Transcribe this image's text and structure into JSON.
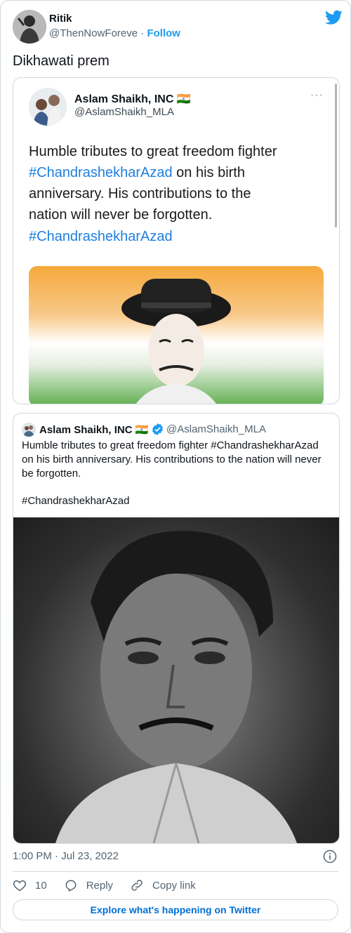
{
  "author": {
    "name": "Ritik",
    "handle": "@ThenNowForeve",
    "separator": "·",
    "follow_label": "Follow"
  },
  "tweet_text": "Dikhawati prem",
  "screenshot_tweet": {
    "name": "Aslam Shaikh, INC 🇮🇳",
    "handle": "@AslamShaikh_MLA",
    "more": "···",
    "text_lines": [
      "Humble tributes to great freedom fighter",
      "#ChandrashekharAzad",
      " on his birth",
      "anniversary. His contributions to the",
      "nation will never be forgotten."
    ],
    "hashtag": "#ChandrashekharAzad"
  },
  "quoted_tweet": {
    "name": "Aslam Shaikh, INC 🇮🇳",
    "handle": "@AslamShaikh_MLA",
    "text_lines": [
      "Humble tributes to great freedom fighter #ChandrashekharAzad",
      "on his birth anniversary. His contributions to the nation will never",
      "be forgotten."
    ],
    "hashtag": "#ChandrashekharAzad"
  },
  "meta": {
    "timestamp": "1:00 PM · Jul 23, 2022"
  },
  "actions": {
    "likes": "10",
    "reply_label": "Reply",
    "copy_label": "Copy link"
  },
  "explore_label": "Explore what's happening on Twitter",
  "colors": {
    "accent": "#1d9bf0",
    "border": "#cfd9de",
    "secondary_text": "#536471",
    "verified": "#1d9bf0"
  }
}
